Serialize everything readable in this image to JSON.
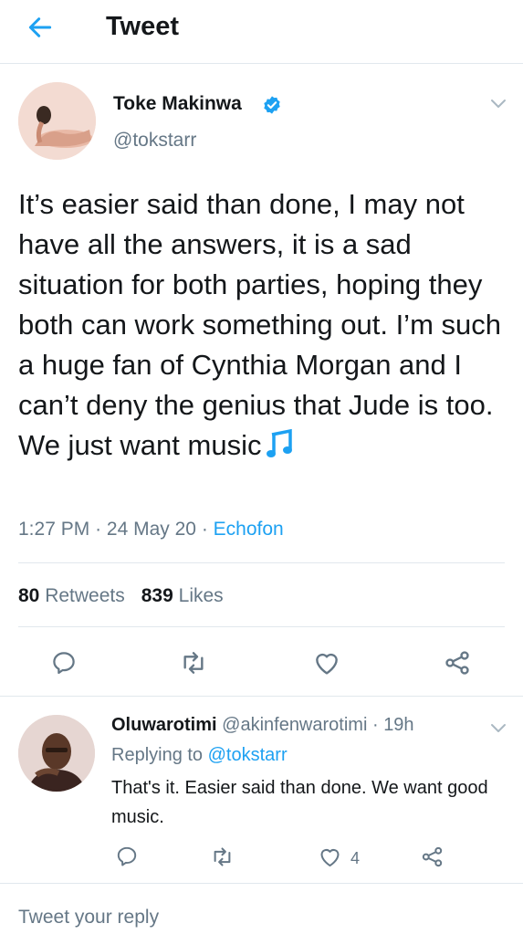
{
  "header": {
    "title": "Tweet",
    "back_icon": "arrow-left-icon"
  },
  "tweet": {
    "author_name": "Toke Makinwa",
    "author_handle": "@tokstarr",
    "verified": true,
    "text": "It’s easier said than done, I may not have all the answers, it is a sad situation for both parties, hoping they both can work something out. I’m such a huge fan of Cynthia Morgan and I can’t deny the genius that Jude is too. We just want music",
    "emoji": "musical-note-icon",
    "time": "1:27 PM",
    "sep1": "·",
    "date": "24 May 20",
    "sep2": "·",
    "source": "Echofon",
    "retweets_count": "80",
    "retweets_label": "Retweets",
    "likes_count": "839",
    "likes_label": "Likes"
  },
  "reply": {
    "name": "Oluwarotimi",
    "handle": "@akinfenwarotimi",
    "sep": "·",
    "time": "19h",
    "replying_prefix": "Replying to",
    "replying_handle": "@tokstarr",
    "text": "That's it. Easier said than done. We want good music.",
    "likes_count": "4"
  },
  "compose": {
    "placeholder": "Tweet your reply"
  },
  "colors": {
    "accent": "#1da1f2",
    "muted": "#657786",
    "text": "#14171a",
    "border": "#e1e8ed"
  }
}
